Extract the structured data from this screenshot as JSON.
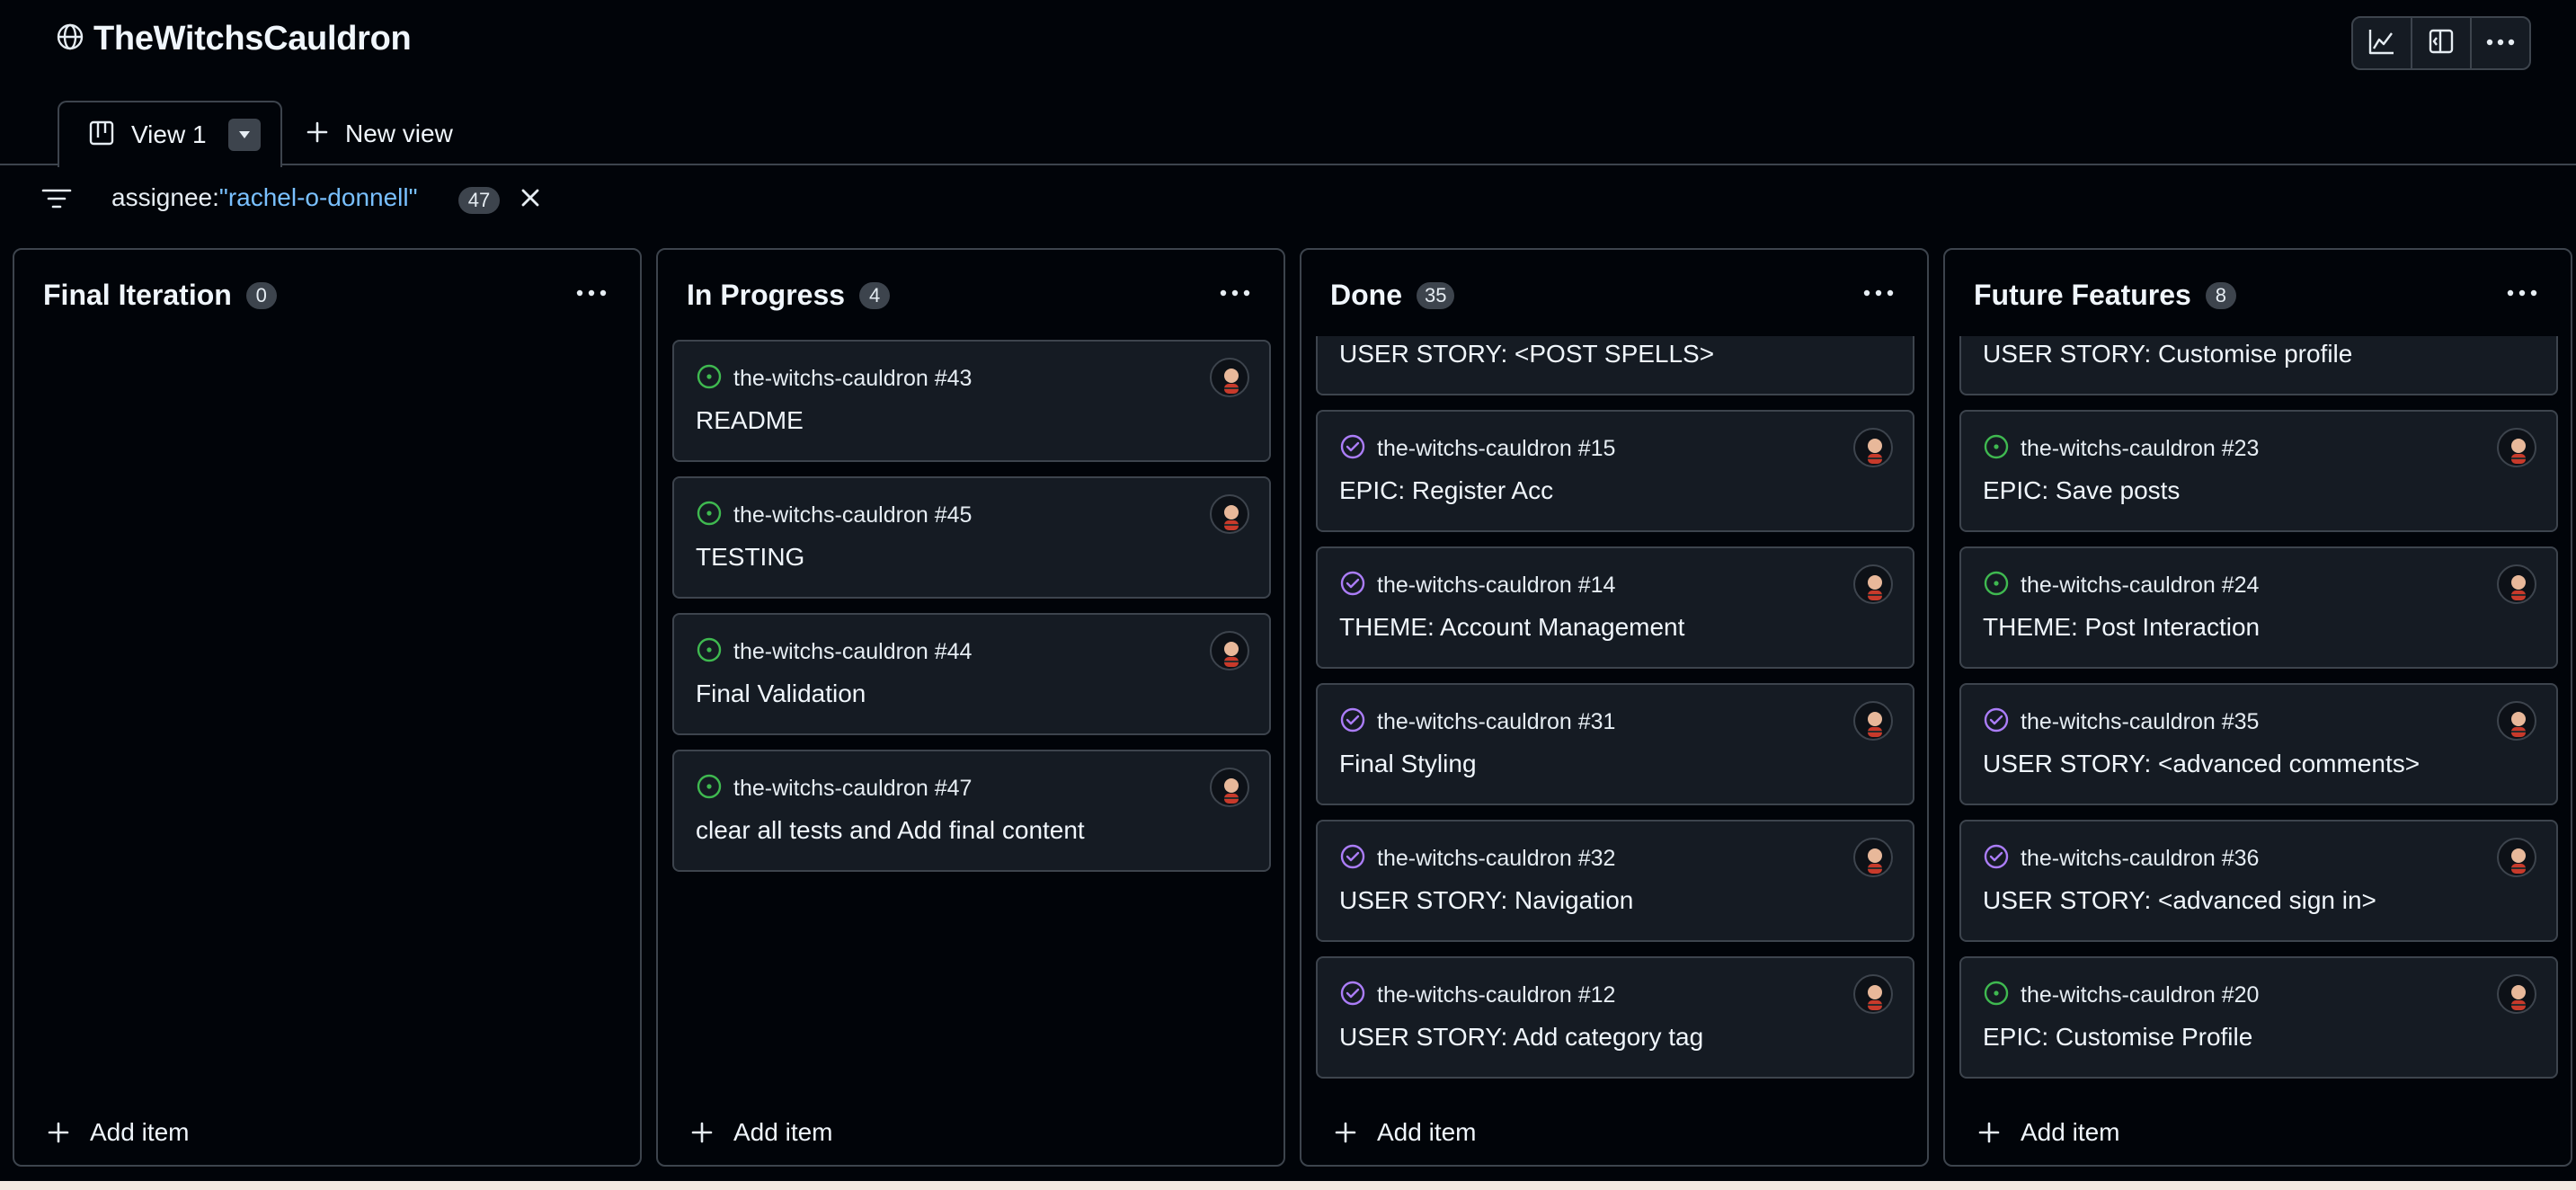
{
  "project": {
    "title": "TheWitchsCauldron"
  },
  "toolbar": {
    "buttons": [
      "insights-icon",
      "side-panel-icon",
      "more-icon"
    ]
  },
  "tabs": {
    "active_label": "View 1",
    "new_view_label": "New view"
  },
  "filter": {
    "key": "assignee:",
    "value": "\"rachel-o-donnell\"",
    "count": "47"
  },
  "colors": {
    "open_status": "#3fb950",
    "closed_status": "#ab7df8",
    "filter_value": "#79c0ff"
  },
  "add_item_label": "Add item",
  "columns": [
    {
      "title": "Final Iteration",
      "count": "0",
      "cards": []
    },
    {
      "title": "In Progress",
      "count": "4",
      "cards": [
        {
          "repo": "the-witchs-cauldron #43",
          "title": "README",
          "status": "open"
        },
        {
          "repo": "the-witchs-cauldron #45",
          "title": "TESTING",
          "status": "open"
        },
        {
          "repo": "the-witchs-cauldron #44",
          "title": "Final Validation",
          "status": "open"
        },
        {
          "repo": "the-witchs-cauldron #47",
          "title": "clear all tests and Add final content",
          "status": "open"
        }
      ]
    },
    {
      "title": "Done",
      "count": "35",
      "cards": [
        {
          "repo": "",
          "title": "USER STORY: <POST SPELLS>",
          "status": "closed"
        },
        {
          "repo": "the-witchs-cauldron #15",
          "title": "EPIC: Register Acc",
          "status": "closed"
        },
        {
          "repo": "the-witchs-cauldron #14",
          "title": "THEME: Account Management",
          "status": "closed"
        },
        {
          "repo": "the-witchs-cauldron #31",
          "title": "Final Styling",
          "status": "closed"
        },
        {
          "repo": "the-witchs-cauldron #32",
          "title": "USER STORY: Navigation",
          "status": "closed"
        },
        {
          "repo": "the-witchs-cauldron #12",
          "title": "USER STORY: Add category tag",
          "status": "closed"
        }
      ]
    },
    {
      "title": "Future Features",
      "count": "8",
      "cards": [
        {
          "repo": "",
          "title": "USER STORY: Customise profile",
          "status": "open"
        },
        {
          "repo": "the-witchs-cauldron #23",
          "title": "EPIC: Save posts",
          "status": "open"
        },
        {
          "repo": "the-witchs-cauldron #24",
          "title": "THEME: Post Interaction",
          "status": "open"
        },
        {
          "repo": "the-witchs-cauldron #35",
          "title": "USER STORY: <advanced comments>",
          "status": "closed"
        },
        {
          "repo": "the-witchs-cauldron #36",
          "title": "USER STORY: <advanced sign in>",
          "status": "closed"
        },
        {
          "repo": "the-witchs-cauldron #20",
          "title": "EPIC: Customise Profile",
          "status": "open"
        }
      ]
    }
  ]
}
